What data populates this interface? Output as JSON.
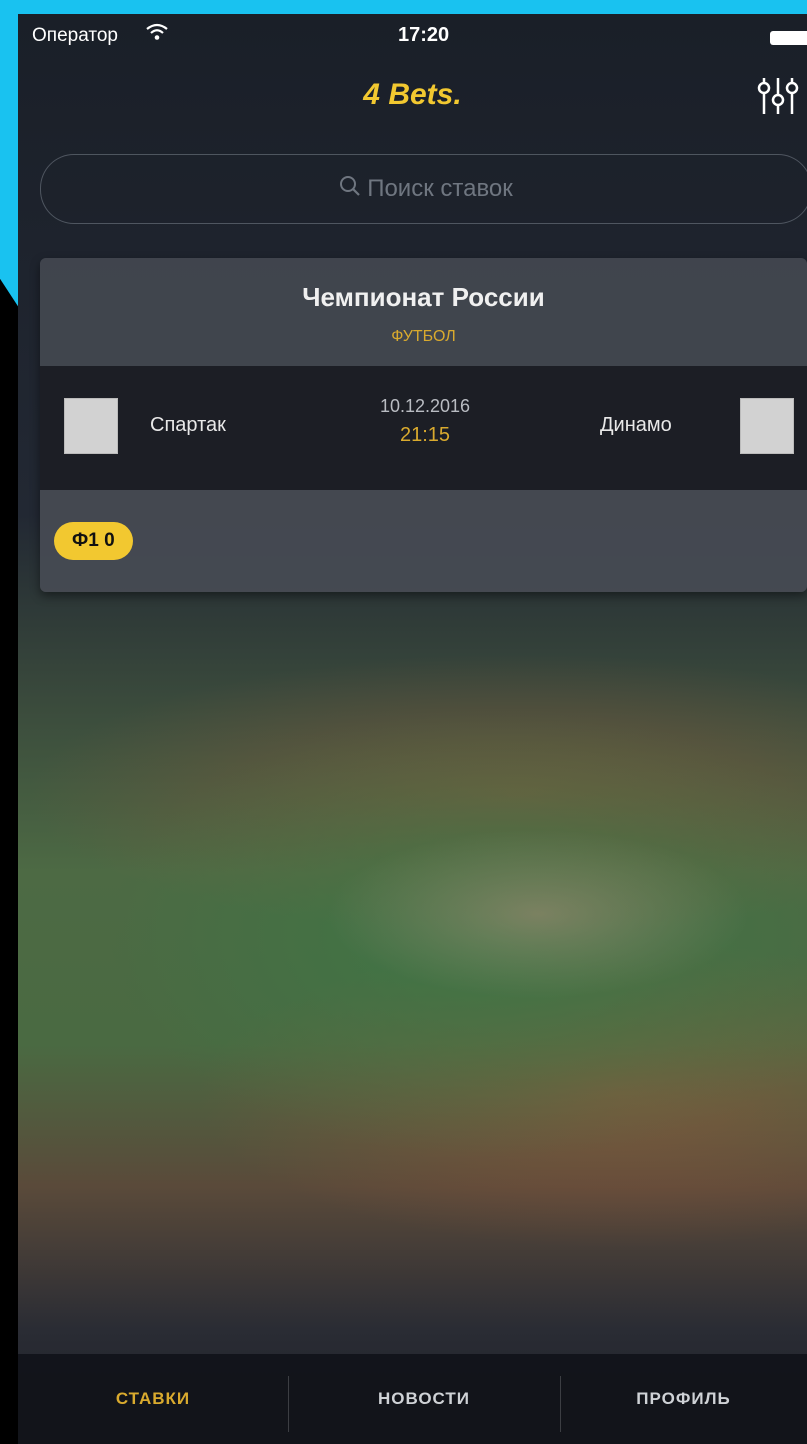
{
  "status": {
    "carrier": "Оператор",
    "wifi_icon": "wifi-icon",
    "time": "17:20",
    "battery_icon": "battery-icon"
  },
  "header": {
    "logo_text": "4 Bets.",
    "filter_icon": "sliders-icon",
    "accent_color": "#f2c830"
  },
  "search": {
    "placeholder": "Поиск ставок",
    "icon": "search-icon"
  },
  "bet_card": {
    "title": "Чемпионат России",
    "sport": "ФУТБОЛ",
    "home_team": "Спартак",
    "away_team": "Динамо",
    "date": "10.12.2016",
    "time": "21:15",
    "bet_label": "Ф1 0"
  },
  "tabs": [
    {
      "label": "СТАВКИ",
      "active": true
    },
    {
      "label": "НОВОСТИ",
      "active": false
    },
    {
      "label": "ПРОФИЛЬ",
      "active": false
    }
  ]
}
